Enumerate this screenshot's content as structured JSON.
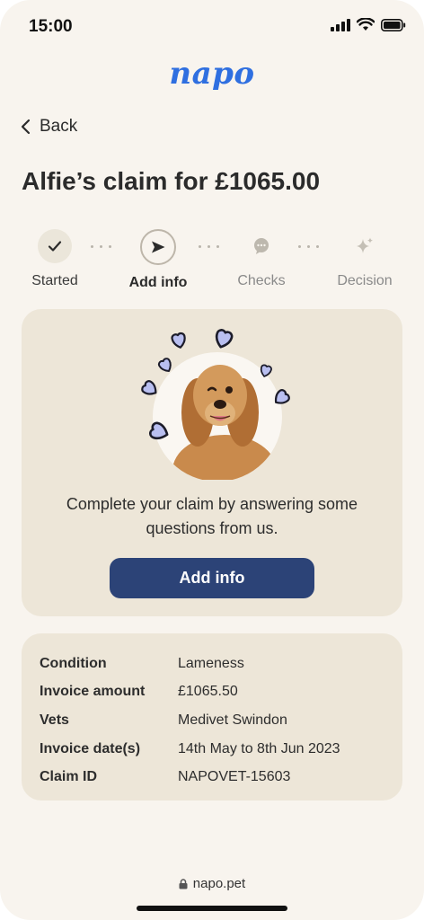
{
  "status": {
    "time": "15:00"
  },
  "brand": {
    "logo": "napo"
  },
  "nav": {
    "back_label": "Back"
  },
  "claim": {
    "title": "Alfie’s claim for £1065.00"
  },
  "steps": [
    {
      "label": "Started",
      "state": "done",
      "icon": "check-icon"
    },
    {
      "label": "Add info",
      "state": "active",
      "icon": "send-arrow-icon"
    },
    {
      "label": "Checks",
      "state": "pending",
      "icon": "chat-bubble-icon"
    },
    {
      "label": "Decision",
      "state": "pending",
      "icon": "sparkle-icon"
    }
  ],
  "action_card": {
    "message": "Complete your claim by answering some questions from us.",
    "button_label": "Add info"
  },
  "details": [
    {
      "key": "Condition",
      "value": "Lameness"
    },
    {
      "key": "Invoice amount",
      "value": "£1065.50"
    },
    {
      "key": "Vets",
      "value": "Medivet Swindon"
    },
    {
      "key": "Invoice date(s)",
      "value": "14th May to 8th Jun 2023"
    },
    {
      "key": "Claim ID",
      "value": "NAPOVET-15603"
    }
  ],
  "browser": {
    "url": "napo.pet"
  },
  "colors": {
    "accent": "#2f6fe0",
    "button": "#2c4377",
    "card": "#ede6d8",
    "background": "#f8f4ee",
    "hearts": "#b9bff0"
  }
}
